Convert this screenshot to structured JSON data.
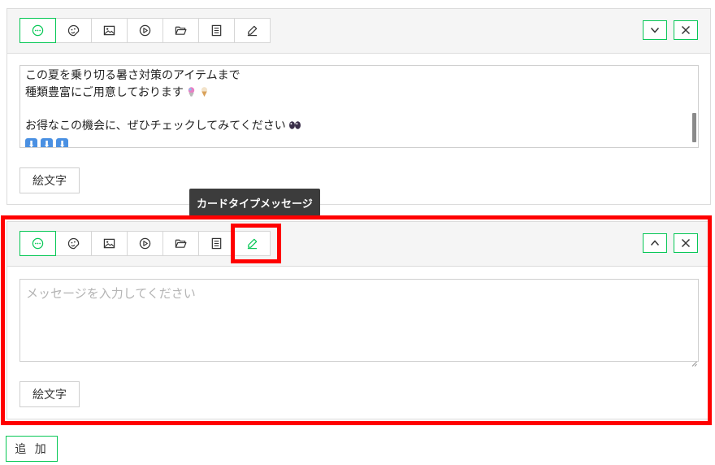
{
  "tooltip": "カードタイプメッセージ",
  "add_button": "追 加",
  "accent_color": "#06c755",
  "highlight_color": "#ff0000",
  "toolbar_icons": [
    "text-message-icon",
    "sticker-icon",
    "image-icon",
    "video-icon",
    "folder-icon",
    "rich-message-icon",
    "card-type-icon"
  ],
  "message1": {
    "lines": [
      "この夏を乗り切る暑さ対策のアイテムまで",
      "種類豊富にご用意しております",
      "",
      "お得なこの機会に、ぜひチェックしてみてください"
    ],
    "arrows": [
      "⬇",
      "⬇",
      "⬇"
    ],
    "emoji_button": "絵文字"
  },
  "message2": {
    "placeholder": "メッセージを入力してください",
    "emoji_button": "絵文字"
  }
}
